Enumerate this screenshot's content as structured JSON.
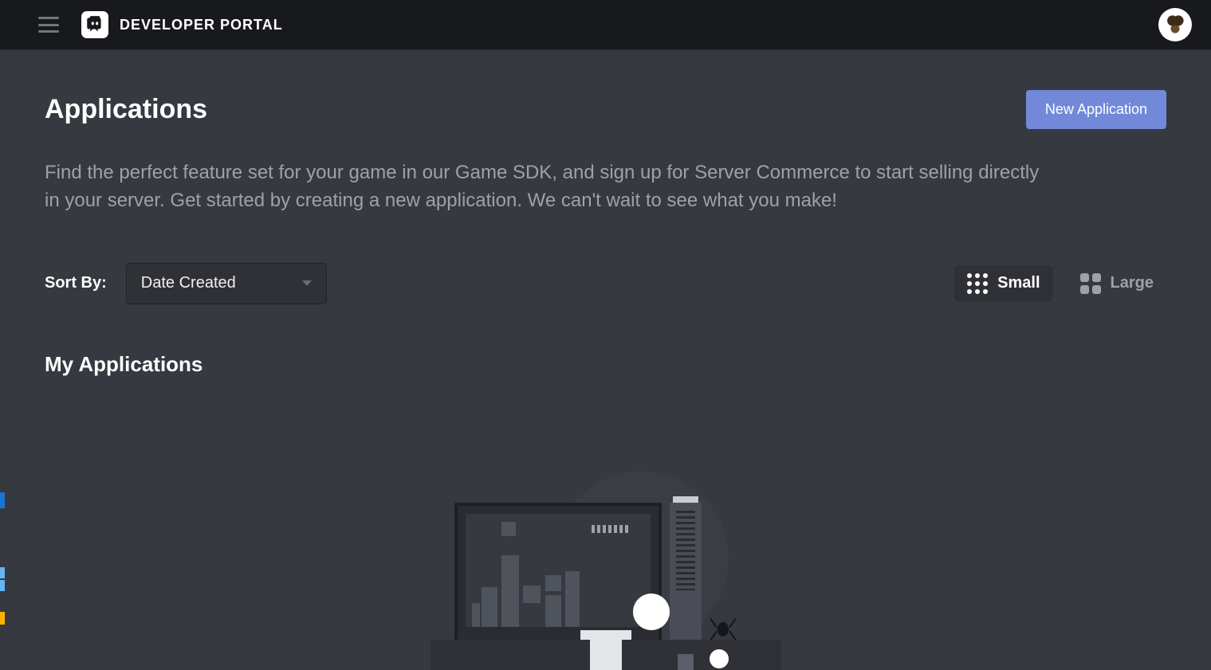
{
  "header": {
    "portal_title": "DEVELOPER PORTAL"
  },
  "page": {
    "title": "Applications",
    "new_app_button": "New Application",
    "description": "Find the perfect feature set for your game in our Game SDK, and sign up for Server Commerce to start selling directly in your server. Get started by creating a new application. We can't wait to see what you make!"
  },
  "sort": {
    "label": "Sort By:",
    "selected": "Date Created"
  },
  "view": {
    "small_label": "Small",
    "large_label": "Large"
  },
  "section": {
    "my_applications": "My Applications"
  }
}
